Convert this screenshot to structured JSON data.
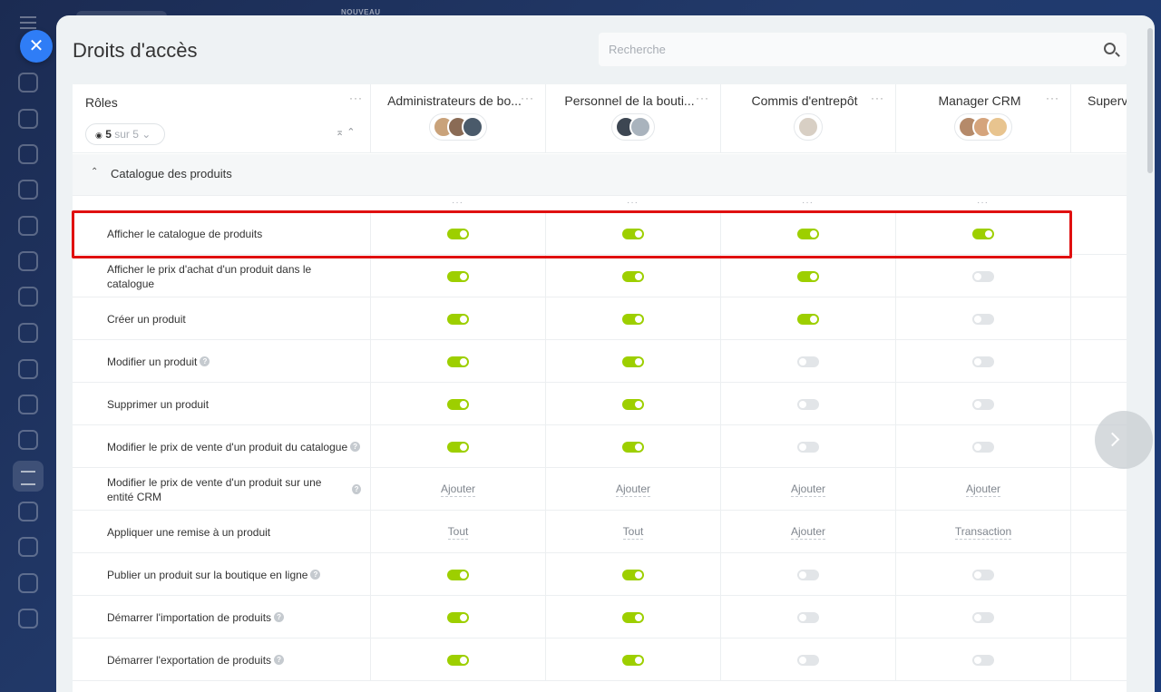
{
  "background": {
    "badge": "NOUVEAU"
  },
  "panel": {
    "title": "Droits d'accès",
    "search_placeholder": "Recherche"
  },
  "table": {
    "roles_label": "Rôles",
    "filter": {
      "count": "5",
      "of": "sur 5"
    },
    "section_label": "Catalogue des produits",
    "columns": [
      {
        "name": "Administrateurs de bo...",
        "avatar_colors": [
          "#c9a27a",
          "#8a6b55",
          "#4a5a6a"
        ]
      },
      {
        "name": "Personnel de la bouti...",
        "avatar_colors": [
          "#3d4652",
          "#a9b3bd"
        ]
      },
      {
        "name": "Commis d'entrepôt",
        "avatar_colors": [
          "#d8cfc4"
        ]
      },
      {
        "name": "Manager CRM",
        "avatar_colors": [
          "#b58a6a",
          "#d5a47c",
          "#e8c48f"
        ]
      },
      {
        "name": "Superv"
      }
    ],
    "rows": [
      {
        "label": "Afficher le catalogue de produits",
        "help": false,
        "values": [
          "on",
          "on",
          "on",
          "on"
        ]
      },
      {
        "label": "Afficher le prix d'achat d'un produit dans le catalogue",
        "help": false,
        "values": [
          "on",
          "on",
          "on",
          "off"
        ]
      },
      {
        "label": "Créer un produit",
        "help": false,
        "values": [
          "on",
          "on",
          "on",
          "off"
        ]
      },
      {
        "label": "Modifier un produit",
        "help": true,
        "values": [
          "on",
          "on",
          "off",
          "off"
        ]
      },
      {
        "label": "Supprimer un produit",
        "help": false,
        "values": [
          "on",
          "on",
          "off",
          "off"
        ]
      },
      {
        "label": "Modifier le prix de vente d'un produit du catalogue",
        "help": true,
        "values": [
          "on",
          "on",
          "off",
          "off"
        ]
      },
      {
        "label": "Modifier le prix de vente d'un produit sur une entité CRM",
        "help": true,
        "values": [
          "Ajouter",
          "Ajouter",
          "Ajouter",
          "Ajouter"
        ]
      },
      {
        "label": "Appliquer une remise à un produit",
        "help": false,
        "values": [
          "Tout",
          "Tout",
          "Ajouter",
          "Transaction"
        ]
      },
      {
        "label": "Publier un produit sur la boutique en ligne",
        "help": true,
        "values": [
          "on",
          "on",
          "off",
          "off"
        ]
      },
      {
        "label": "Démarrer l'importation de produits",
        "help": true,
        "values": [
          "on",
          "on",
          "off",
          "off"
        ]
      },
      {
        "label": "Démarrer l'exportation de produits",
        "help": true,
        "values": [
          "on",
          "on",
          "off",
          "off"
        ]
      }
    ]
  },
  "colors": {
    "toggle_on": "#9dcf00",
    "highlight": "#e01010",
    "accent": "#2f7df6"
  }
}
